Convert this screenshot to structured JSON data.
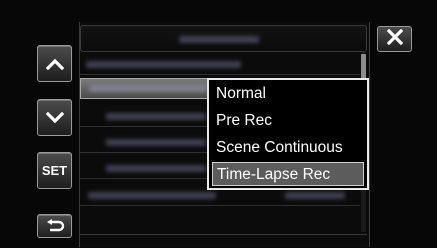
{
  "menu": {
    "options": [
      "Normal",
      "Pre Rec",
      "Scene Continuous",
      "Time-Lapse Rec"
    ],
    "highlighted_option": "Time-Lapse Rec"
  },
  "buttons": {
    "set_label": "SET"
  },
  "icons": {
    "up": "chevron-up-icon",
    "down": "chevron-down-icon",
    "back": "return-arrow-icon",
    "close": "close-icon"
  }
}
